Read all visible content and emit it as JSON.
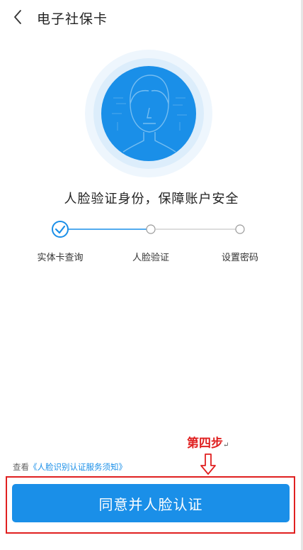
{
  "header": {
    "title": "电子社保卡"
  },
  "main": {
    "headline": "人脸验证身份，保障账户安全",
    "steps": [
      {
        "label": "实体卡查询",
        "done": true
      },
      {
        "label": "人脸验证",
        "done": false
      },
      {
        "label": "设置密码",
        "done": false
      }
    ],
    "terms_prefix": "查看",
    "terms_link": "《人脸识别认证服务须知》"
  },
  "annotation": {
    "step_text": "第四步",
    "return_mark": "↵"
  },
  "footer": {
    "agree_button": "同意并人脸认证"
  },
  "colors": {
    "accent": "#1a8fe8",
    "annotation_red": "#e02020"
  },
  "icons": {
    "back": "chevron-left-icon",
    "face": "face-scan-icon",
    "check": "check-circle-icon",
    "arrow": "down-arrow-icon"
  }
}
